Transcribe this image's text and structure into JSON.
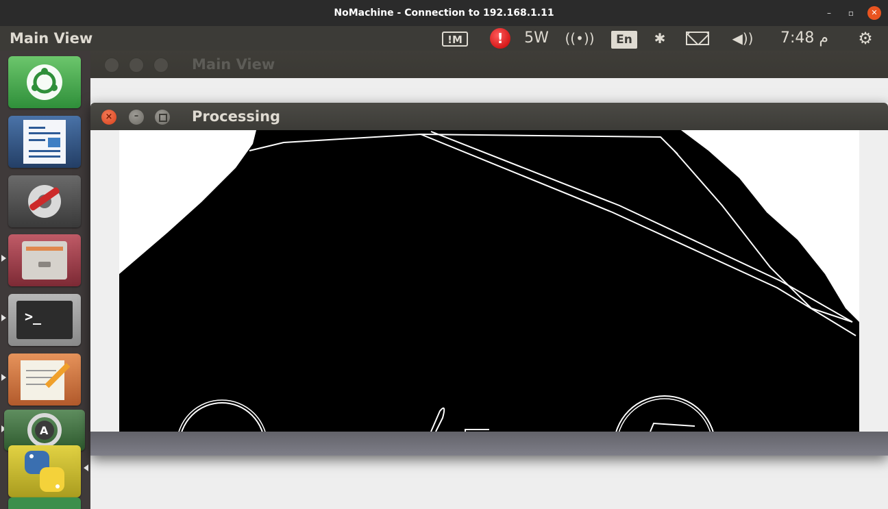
{
  "outer_window": {
    "title": "NoMachine - Connection to 192.168.1.11",
    "minimize_glyph": "–",
    "maximize_glyph": "▫",
    "close_glyph": "✕"
  },
  "top_panel": {
    "title": "Main View",
    "nomachine_indicator": "!M",
    "alert_glyph": "!",
    "power_label": "5W",
    "wifi_glyph": "((•))",
    "keyboard_layout": "En",
    "bluetooth_glyph": "✱",
    "volume_glyph": "◀))",
    "clock": "م 7:48",
    "session_glyph": "⚙"
  },
  "launcher": {
    "items": [
      {
        "name": "dash-home",
        "glyph": "◎"
      },
      {
        "name": "libreoffice-writer",
        "glyph": "▤"
      },
      {
        "name": "system-settings",
        "glyph": "⚙"
      },
      {
        "name": "files",
        "glyph": "▭"
      },
      {
        "name": "terminal",
        "glyph": ">_"
      },
      {
        "name": "text-editor",
        "glyph": "✎"
      },
      {
        "name": "software-updater",
        "glyph": "A"
      },
      {
        "name": "python",
        "glyph": "🐍"
      }
    ]
  },
  "main_window": {
    "title": "Main View"
  },
  "processing_window": {
    "title": "Processing",
    "close_glyph": "×",
    "minimize_glyph": "–"
  }
}
